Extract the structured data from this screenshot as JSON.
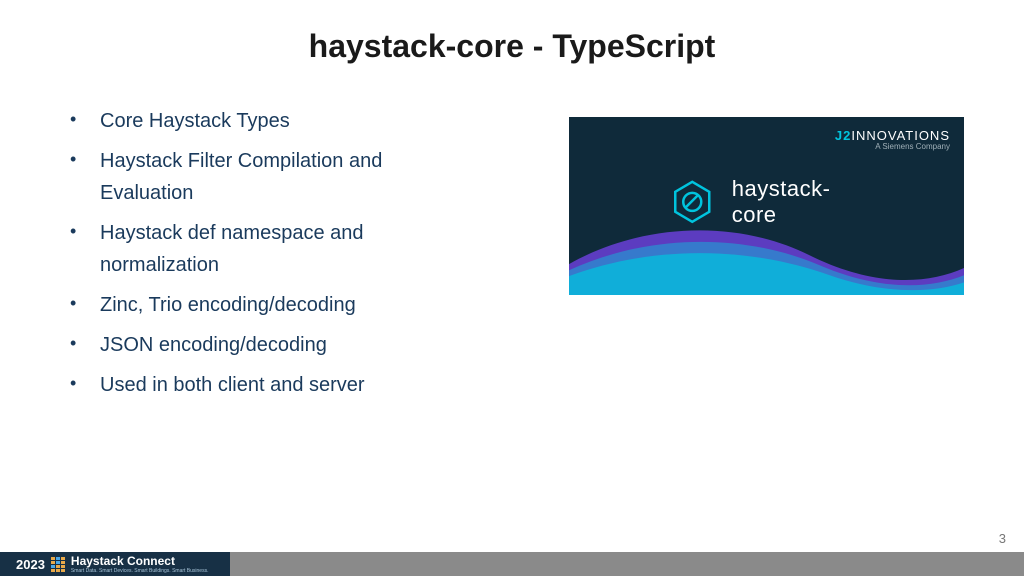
{
  "title": "haystack-core - TypeScript",
  "bullets": [
    "Core Haystack Types",
    "Haystack Filter Compilation and Evaluation",
    "Haystack def namespace and normalization",
    "Zinc, Trio encoding/decoding",
    "JSON encoding/decoding",
    "Used in both client and server"
  ],
  "banner": {
    "brand_prefix": "J2",
    "brand_rest": "INNOVATIONS",
    "brand_sub": "A Siemens Company",
    "lib_name": "haystack-core"
  },
  "page_number": "3",
  "footer": {
    "year": "2023",
    "conference": "Haystack Connect",
    "tagline": "Smart Data. Smart Devices. Smart Buildings. Smart Business."
  }
}
